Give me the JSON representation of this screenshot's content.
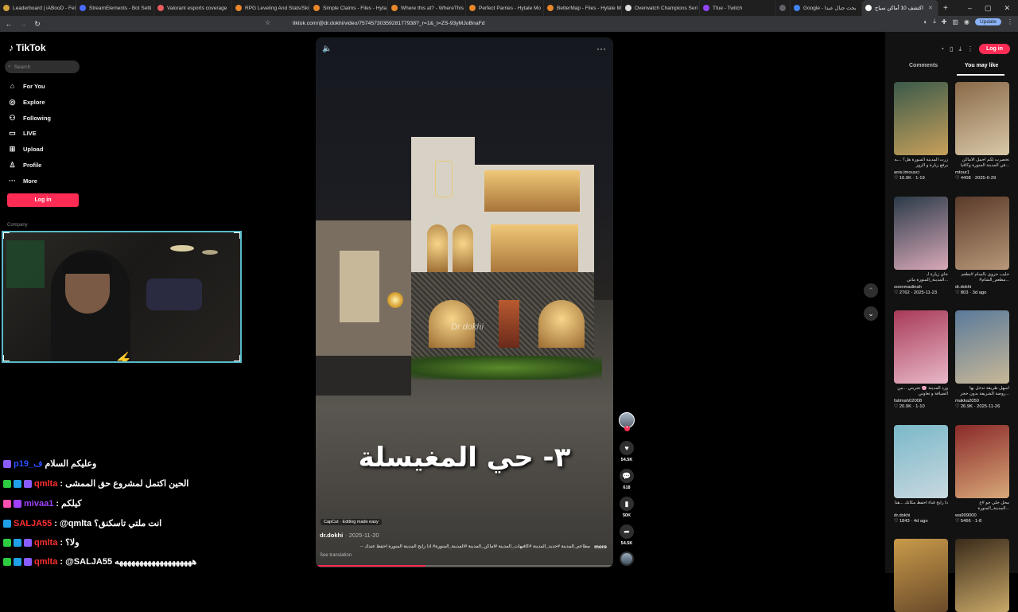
{
  "browser": {
    "tabs": [
      {
        "label": "Leaderboard | iABooD - Fel",
        "color": "#d0a13c"
      },
      {
        "label": "StreamElements - Bot Setti",
        "color": "#4a6cff"
      },
      {
        "label": "Valorant esports coverage",
        "color": "#e85c5c"
      },
      {
        "label": "RPG Leveling And Stats/Ski",
        "color": "#e8862a"
      },
      {
        "label": "Simple Claims - Files - Hyta",
        "color": "#e8862a"
      },
      {
        "label": "Where this at? - WhereThis",
        "color": "#e8862a"
      },
      {
        "label": "Perfect Parries - Hytale Mo",
        "color": "#e8862a"
      },
      {
        "label": "BetterMap - Files - Hytale M",
        "color": "#e8862a"
      },
      {
        "label": "Overwatch Champions Seri",
        "color": "#dddddd"
      },
      {
        "label": "Tfue - Twitch",
        "color": "#9146ff"
      },
      {
        "label": "",
        "color": "#5f6368"
      },
      {
        "label": "Google - بحث جبال عبدا",
        "color": "#4285f4"
      },
      {
        "label": "اكتشف 10 أماكن سياح",
        "color": "#ffffff"
      }
    ],
    "new_tab": "+",
    "window_controls": [
      "–",
      "▢",
      "✕"
    ],
    "url": "tiktok.com/@dr.dokhi/video/7574573035928177938?_r=1&_t=ZS-93yMJoBnaFd",
    "update_label": "Update"
  },
  "sidebar": {
    "logo": "TikTok",
    "search_placeholder": "Search",
    "items": [
      {
        "label": "For You",
        "icon": "home-icon"
      },
      {
        "label": "Explore",
        "icon": "compass-icon"
      },
      {
        "label": "Following",
        "icon": "following-icon"
      },
      {
        "label": "LIVE",
        "icon": "live-icon"
      },
      {
        "label": "Upload",
        "icon": "upload-icon"
      },
      {
        "label": "Profile",
        "icon": "profile-icon"
      },
      {
        "label": "More",
        "icon": "more-icon"
      }
    ],
    "login_label": "Log in",
    "company_label": "Company"
  },
  "chat": [
    {
      "name": "p19_ف",
      "name_color": "#2a4fff",
      "message": "وعليكم السلام"
    },
    {
      "name": "qmlta",
      "name_color": "#ff3030",
      "message": ": الحين اكتمل لمشروع حق الممشى"
    },
    {
      "name": "mivaa1",
      "name_color": "#a040ff",
      "message": ": كيلكم"
    },
    {
      "name": "SALJA55",
      "name_color": "#ff3030",
      "message": ": @qmlta انت ملتي تاسكنق؟"
    },
    {
      "name": "qmlta",
      "name_color": "#ff3030",
      "message": ": ولا؟"
    },
    {
      "name": "qmlta",
      "name_color": "#ff3030",
      "message": ": @SALJA55 هههههههههههههههههههه"
    }
  ],
  "video": {
    "overlay_title": "٣- حي المغيسلة",
    "watermark": "Dr dokhi",
    "capcut": "CapCut · Editing made easy",
    "author": "dr.dokhi",
    "date": "· 2025-11-20",
    "description": "مطاعم_المدينة #جديد_المدينة #كافيهات_المدينة #أماكن_المدينة #المدينة_المنورة# اذا رايح المدينة المنورة احفظ عندك --",
    "more_label": "more",
    "see_translation": "See translation",
    "progress": 0.37
  },
  "actions": {
    "likes": "54.5K",
    "comments": "618",
    "saves": "50K",
    "shares": "54.5K"
  },
  "right_panel": {
    "login_label": "Log in",
    "tab_comments": "Comments",
    "tab_you_may_like": "You may like",
    "cards": [
      {
        "title": "زرت المدينة المنورة هل؟ ...ـه يرفع زيارة و الزور",
        "user": "anis.lmousci",
        "likes": "16.9K",
        "date": "1-19",
        "color1": "#3a5a4a",
        "color2": "#c8a05a"
      },
      {
        "title": "تحصرت لكم اجمل الاماكن ...في المدينة المنورة وكافيا",
        "user": "mtour1",
        "likes": "4408",
        "date": "2025-6-29",
        "color1": "#8a6a48",
        "color2": "#d8c8a8"
      },
      {
        "title": "جاي زيارة لـ ...المدينة_المنورة ماني",
        "user": "soonmadinah",
        "likes": "2762",
        "date": "2025-11-23",
        "color1": "#2a3a48",
        "color2": "#d8a8b8"
      },
      {
        "title": "حليب جروي بالسام #بطعم ...مطعم_الشام#",
        "user": "dr.dokhi",
        "likes": "803",
        "date": "3d ago",
        "color1": "#5a3a2a",
        "color2": "#b89878"
      },
      {
        "title": "ورد المدينة 🌸 تجربتي ...من الضيافة و تعاوني",
        "user": "fatimah02008",
        "likes": "20.9K",
        "date": "1-10",
        "color1": "#a83a58",
        "color2": "#e8b8c8"
      },
      {
        "title": "اسهل طريقة تدخل بها ...روضة الشريفة بدون حجز",
        "user": "makka2050",
        "likes": "26.9K",
        "date": "2025-11-26",
        "color1": "#5a7a9a",
        "color2": "#c8b898"
      },
      {
        "title": "ذا رايح قباء احفظ مكانك ...هنا",
        "user": "dr.dokhi",
        "likes": "1843",
        "date": "4d ago",
        "color1": "#7ab8c8",
        "color2": "#c8d8e0"
      },
      {
        "title": "محل جلي جو #ع ...المدينة_المنورة",
        "user": "wa909000",
        "likes": "5466",
        "date": "1-8",
        "color1": "#8a2a2a",
        "color2": "#d8a878"
      },
      {
        "title": "",
        "user": "",
        "likes": "",
        "date": "",
        "color1": "#c89a4a",
        "color2": "#6a4a2a"
      },
      {
        "title": "",
        "user": "",
        "likes": "",
        "date": "",
        "color1": "#3a2a1a",
        "color2": "#c8a868"
      }
    ]
  },
  "colors": {
    "accent": "#fe2c55",
    "cam_border": "#58b8c8"
  }
}
